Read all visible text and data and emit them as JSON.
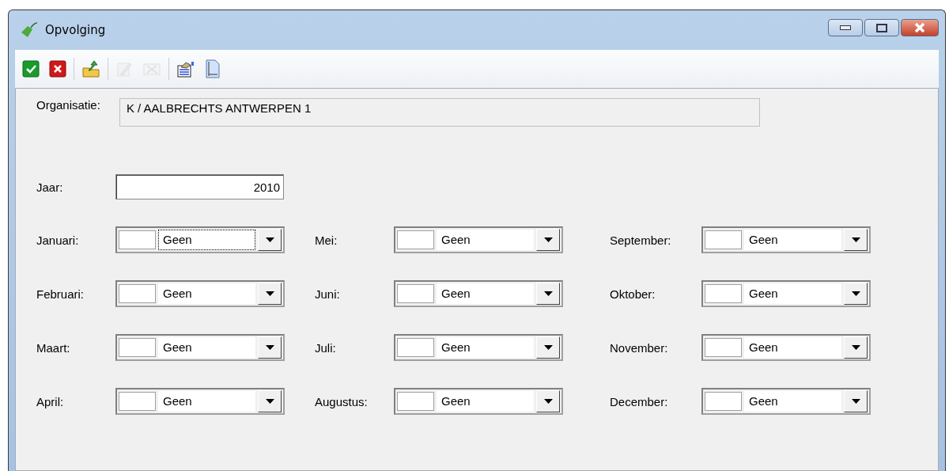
{
  "window": {
    "title": "Opvolging"
  },
  "toolbar": [
    {
      "kind": "confirm",
      "disabled": false
    },
    {
      "kind": "cancel",
      "disabled": false
    },
    {
      "kind": "export",
      "disabled": false
    },
    {
      "kind": "edit",
      "disabled": true
    },
    {
      "kind": "delete",
      "disabled": true
    },
    {
      "kind": "properties",
      "disabled": false
    },
    {
      "kind": "page",
      "disabled": false
    }
  ],
  "organisation": {
    "label": "Organisatie:",
    "value": "K / AALBRECHTS ANTWERPEN 1"
  },
  "year": {
    "label": "Jaar:",
    "value": "2010"
  },
  "months": [
    {
      "label": "Januari:",
      "value": "Geen",
      "focused": true
    },
    {
      "label": "Februari:",
      "value": "Geen",
      "focused": false
    },
    {
      "label": "Maart:",
      "value": "Geen",
      "focused": false
    },
    {
      "label": "April:",
      "value": "Geen",
      "focused": false
    },
    {
      "label": "Mei:",
      "value": "Geen",
      "focused": false
    },
    {
      "label": "Juni:",
      "value": "Geen",
      "focused": false
    },
    {
      "label": "Juli:",
      "value": "Geen",
      "focused": false
    },
    {
      "label": "Augustus:",
      "value": "Geen",
      "focused": false
    },
    {
      "label": "September:",
      "value": "Geen",
      "focused": false
    },
    {
      "label": "Oktober:",
      "value": "Geen",
      "focused": false
    },
    {
      "label": "November:",
      "value": "Geen",
      "focused": false
    },
    {
      "label": "December:",
      "value": "Geen",
      "focused": false
    }
  ]
}
